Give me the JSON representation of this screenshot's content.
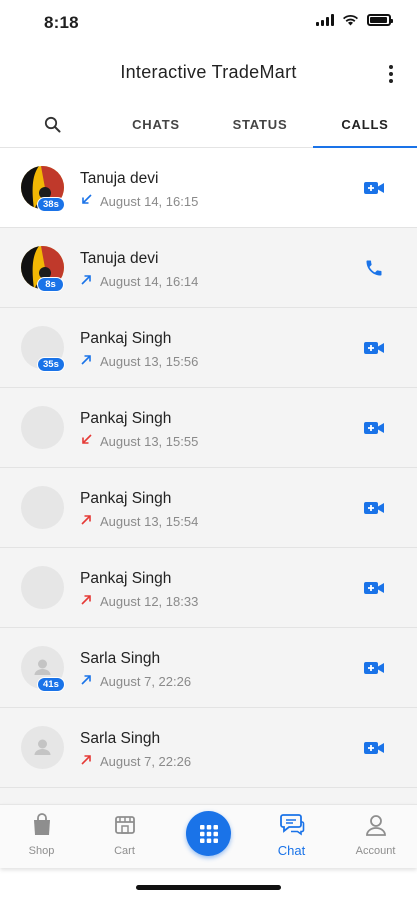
{
  "status_bar": {
    "time": "8:18"
  },
  "header": {
    "title": "Interactive TradeMart"
  },
  "tabs": [
    {
      "label": "CHATS"
    },
    {
      "label": "STATUS"
    },
    {
      "label": "CALLS",
      "active": true
    }
  ],
  "calls": [
    {
      "name": "Tanuja devi",
      "time": "August 14, 16:15",
      "direction": "incoming",
      "missed": false,
      "type": "video",
      "duration": "38s",
      "avatar": "photo"
    },
    {
      "name": "Tanuja devi",
      "time": "August 14, 16:14",
      "direction": "outgoing",
      "missed": false,
      "type": "voice",
      "duration": "8s",
      "avatar": "photo"
    },
    {
      "name": "Pankaj Singh",
      "time": "August 13, 15:56",
      "direction": "outgoing",
      "missed": false,
      "type": "video",
      "duration": "35s",
      "avatar": "blank"
    },
    {
      "name": "Pankaj Singh",
      "time": "August 13, 15:55",
      "direction": "incoming",
      "missed": true,
      "type": "video",
      "duration": "",
      "avatar": "blank"
    },
    {
      "name": "Pankaj Singh",
      "time": "August 13, 15:54",
      "direction": "outgoing",
      "missed": true,
      "type": "video",
      "duration": "",
      "avatar": "blank"
    },
    {
      "name": "Pankaj Singh",
      "time": "August 12, 18:33",
      "direction": "outgoing",
      "missed": true,
      "type": "video",
      "duration": "",
      "avatar": "blank"
    },
    {
      "name": "Sarla Singh",
      "time": "August 7, 22:26",
      "direction": "outgoing",
      "missed": false,
      "type": "video",
      "duration": "41s",
      "avatar": "person"
    },
    {
      "name": "Sarla Singh",
      "time": "August 7, 22:26",
      "direction": "outgoing",
      "missed": true,
      "type": "video",
      "duration": "",
      "avatar": "person"
    }
  ],
  "bottom_nav": {
    "shop_label": "Shop",
    "cart_label": "Cart",
    "chat_label": "Chat",
    "account_label": "Account"
  },
  "colors": {
    "accent": "#1a73e8",
    "missed": "#e53935",
    "text_secondary": "#8a8a8a"
  }
}
